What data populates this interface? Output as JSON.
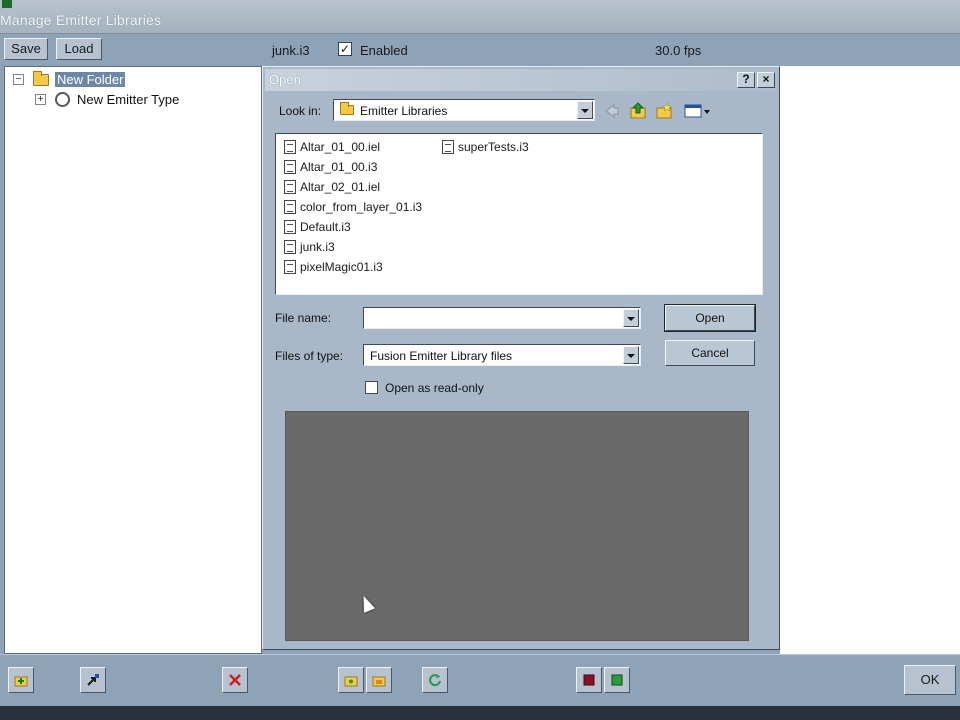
{
  "window": {
    "title": "Manage Emitter Libraries"
  },
  "toolbar": {
    "save_label": "Save",
    "load_label": "Load",
    "file_name": "junk.i3",
    "enabled_label": "Enabled",
    "enabled_checked": "✓",
    "fps": "30.0 fps"
  },
  "tree": {
    "folder_label": "New Folder",
    "folder_toggle": "−",
    "emitter_label": "New Emitter Type",
    "emitter_toggle": "+"
  },
  "dialog": {
    "title": "Open",
    "help_glyph": "?",
    "close_glyph": "×",
    "look_in_label": "Look in:",
    "look_in_value": "Emitter Libraries",
    "files": [
      "Altar_01_00.iel",
      "Altar_01_00.i3",
      "Altar_02_01.iel",
      "color_from_layer_01.i3",
      "Default.i3",
      "junk.i3",
      "pixelMagic01.i3",
      "superTests.i3"
    ],
    "file_name_label": "File name:",
    "file_name_value": "",
    "files_of_type_label": "Files of type:",
    "files_of_type_value": "Fusion Emitter Library files",
    "open_button": "Open",
    "cancel_button": "Cancel",
    "read_only_label": "Open as read-only"
  },
  "bottom": {
    "ok_label": "OK"
  },
  "colors": {
    "chrome": "#8fa3b8",
    "dialog": "#a9b8c8",
    "selection": "#6e87a6",
    "preview": "#6a6a6a",
    "delete_red": "#d02020",
    "refresh_green": "#2a9a3a"
  }
}
